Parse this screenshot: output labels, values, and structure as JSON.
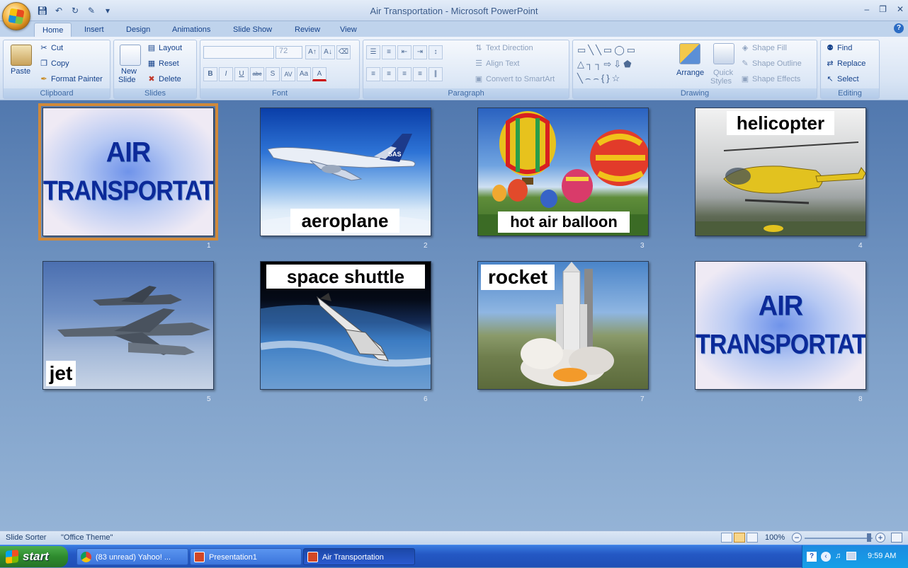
{
  "window": {
    "title": "Air Transportation - Microsoft PowerPoint"
  },
  "qat": {
    "save": "save-icon",
    "undo": "undo-icon",
    "redo": "redo-icon",
    "customize": "▾"
  },
  "tabs": [
    "Home",
    "Insert",
    "Design",
    "Animations",
    "Slide Show",
    "Review",
    "View"
  ],
  "ribbon": {
    "clipboard": {
      "label": "Clipboard",
      "paste": "Paste",
      "cut": "Cut",
      "copy": "Copy",
      "format_painter": "Format Painter"
    },
    "slides": {
      "label": "Slides",
      "new_slide": "New",
      "new_slide2": "Slide",
      "layout": "Layout",
      "reset": "Reset",
      "delete": "Delete"
    },
    "font": {
      "label": "Font",
      "font_name": "",
      "font_size": "72",
      "bold": "B",
      "italic": "I",
      "underline": "U",
      "strike": "abc",
      "shadow": "S",
      "spacing": "AV",
      "case": "Aa",
      "color": "A"
    },
    "paragraph": {
      "label": "Paragraph",
      "text_direction": "Text Direction",
      "align_text": "Align Text",
      "convert_smartart": "Convert to SmartArt"
    },
    "drawing": {
      "label": "Drawing",
      "arrange": "Arrange",
      "quick_styles": "Quick",
      "quick_styles2": "Styles",
      "shape_fill": "Shape Fill",
      "shape_outline": "Shape Outline",
      "shape_effects": "Shape Effects"
    },
    "editing": {
      "label": "Editing",
      "find": "Find",
      "replace": "Replace",
      "select": "Select"
    }
  },
  "slides": [
    {
      "num": "1",
      "type": "title",
      "line1": "AIR",
      "line2": "TRANSPORTATION",
      "selected": true
    },
    {
      "num": "2",
      "type": "photo",
      "caption": "aeroplane",
      "image": "airliner-in-sky"
    },
    {
      "num": "3",
      "type": "photo",
      "caption": "hot air balloon",
      "image": "hot-air-balloons"
    },
    {
      "num": "4",
      "type": "photo",
      "caption": "helicopter",
      "image": "yellow-helicopter"
    },
    {
      "num": "5",
      "type": "photo",
      "caption": "jet",
      "image": "fighter-jets"
    },
    {
      "num": "6",
      "type": "photo",
      "caption": "space shuttle",
      "image": "shuttle-over-earth"
    },
    {
      "num": "7",
      "type": "photo",
      "caption": "rocket",
      "image": "rocket-launch"
    },
    {
      "num": "8",
      "type": "title",
      "line1": "AIR",
      "line2": "TRANSPORTATION",
      "selected": false
    }
  ],
  "statusbar": {
    "view": "Slide Sorter",
    "theme": "\"Office Theme\"",
    "zoom": "100%"
  },
  "taskbar": {
    "start": "start",
    "tasks": [
      {
        "label": "(83 unread) Yahoo! ...",
        "icon": "chrome-icon"
      },
      {
        "label": "Presentation1",
        "icon": "powerpoint-icon"
      },
      {
        "label": "Air Transportation",
        "icon": "powerpoint-icon"
      }
    ],
    "clock": "9:59 AM"
  },
  "colors": {
    "accent": "#15428b",
    "selection": "#d0893a",
    "title_text": "#0c2a99"
  }
}
